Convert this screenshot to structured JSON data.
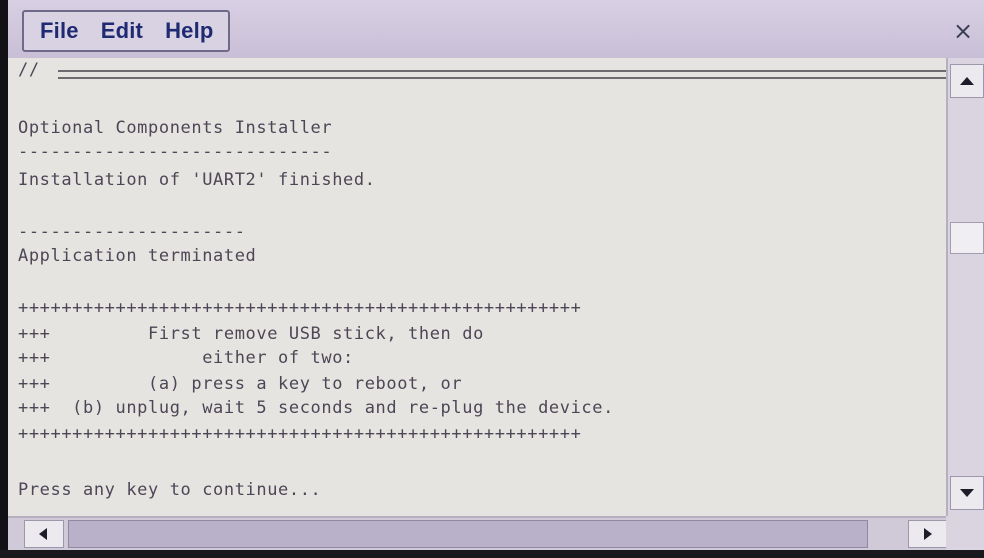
{
  "menu": {
    "file": "File",
    "edit": "Edit",
    "help": "Help"
  },
  "window": {
    "close_glyph": "×"
  },
  "console": {
    "lines": [
      "//",
      "Optional Components Installer",
      "-----------------------------",
      "Installation of 'UART2' finished.",
      "---------------------",
      "Application terminated",
      "++++++++++++++++++++++++++++++++++++++++++++++++++++",
      "+++         First remove USB stick, then do",
      "+++              either of two:",
      "+++         (a) press a key to reboot, or",
      "+++  (b) unplug, wait 5 seconds and re-plug the device.",
      "++++++++++++++++++++++++++++++++++++++++++++++++++++",
      "Press any key to continue..."
    ]
  },
  "icons": {
    "close": "close-icon",
    "scroll_up": "arrow-up-icon",
    "scroll_down": "arrow-down-icon",
    "scroll_left": "arrow-left-icon",
    "scroll_right": "arrow-right-icon"
  },
  "colors": {
    "menu_text": "#1f2a73",
    "console_text": "#4d4656",
    "console_bg": "#e6e4e0",
    "chrome_bg": "#d8cfe3"
  }
}
